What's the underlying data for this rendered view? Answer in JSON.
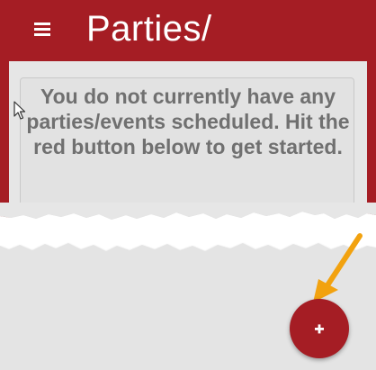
{
  "app_bar": {
    "title": "Parties/",
    "menu_icon": "hamburger-menu-icon",
    "background": "#a51d24"
  },
  "empty_state": {
    "message": "You do not currently have any parties/events scheduled.  Hit the red button below to get started."
  },
  "fab": {
    "icon": "plus-icon",
    "background": "#a51d24"
  },
  "annotation": {
    "icon": "orange-arrow-icon",
    "color": "#f2a20f"
  },
  "colors": {
    "content_background": "#e4e4e4",
    "message_text": "#707070"
  }
}
